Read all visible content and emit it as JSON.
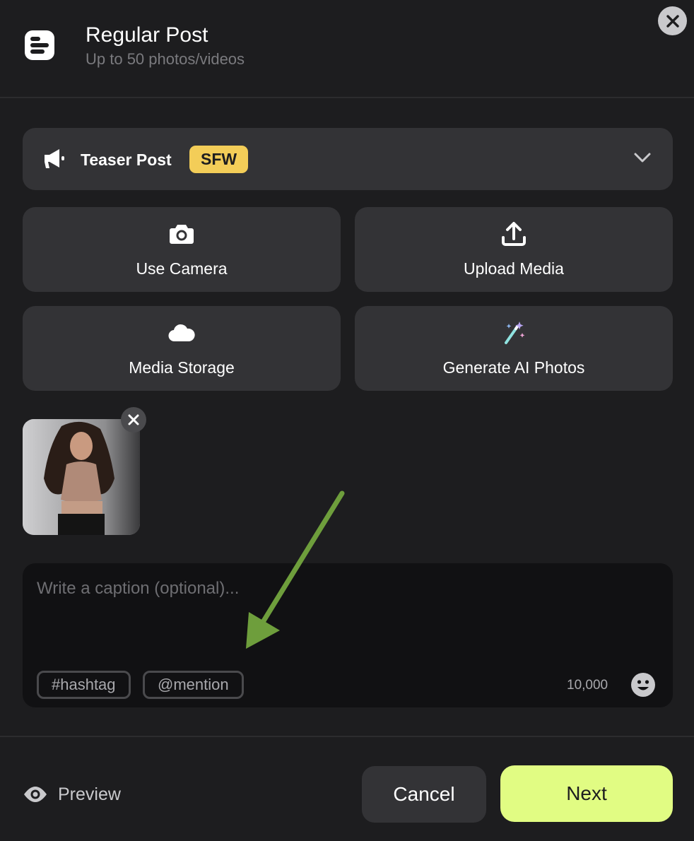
{
  "header": {
    "title": "Regular Post",
    "subtitle": "Up to 50 photos/videos",
    "post_type_icon": "post-lines-icon",
    "close_icon": "close-icon"
  },
  "audience": {
    "label": "Teaser Post",
    "badge": "SFW",
    "icon": "megaphone-icon",
    "dropdown_icon": "chevron-down-icon"
  },
  "media_options": [
    {
      "label": "Use Camera",
      "icon": "camera-icon"
    },
    {
      "label": "Upload Media",
      "icon": "upload-icon"
    },
    {
      "label": "Media Storage",
      "icon": "cloud-icon"
    },
    {
      "label": "Generate AI Photos",
      "icon": "magic-wand-icon"
    }
  ],
  "attached_media": {
    "count": 1,
    "remove_icon": "close-icon"
  },
  "caption": {
    "value": "",
    "placeholder": "Write a caption (optional)...",
    "hashtag_label": "#hashtag",
    "mention_label": "@mention",
    "char_limit": "10,000",
    "emoji_icon": "smiley-icon"
  },
  "footer": {
    "preview_label": "Preview",
    "preview_icon": "eye-icon",
    "cancel_label": "Cancel",
    "next_label": "Next"
  },
  "colors": {
    "background": "#1d1d1f",
    "card": "#333336",
    "accent": "#e1fc83",
    "badge": "#f3cd58",
    "annotation_arrow": "#6e9e3c"
  }
}
